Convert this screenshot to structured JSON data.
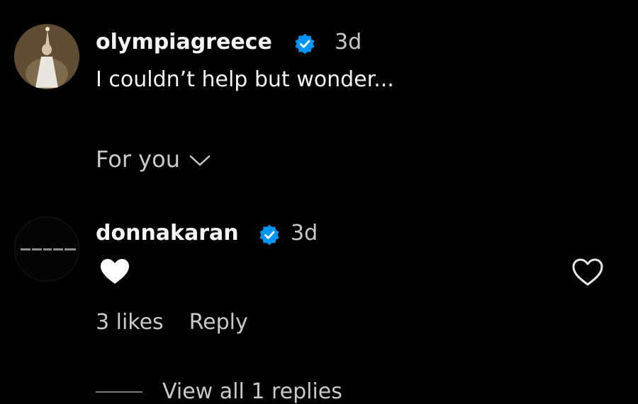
{
  "post": {
    "author": "olympiagreece",
    "verified_icon": "verified-badge-icon",
    "time": "3d",
    "caption": "I couldn’t help but wonder..."
  },
  "sort": {
    "label": "For you",
    "icon": "chevron-down-icon"
  },
  "comment": {
    "author": "donnakaran",
    "verified_icon": "verified-badge-icon",
    "time": "3d",
    "text_icon": "white-heart-emoji",
    "likes": "3 likes",
    "reply_label": "Reply",
    "like_icon": "heart-outline-icon",
    "view_replies": "View all 1 replies"
  },
  "colors": {
    "background": "#000000",
    "text_primary": "#f5f5f5",
    "text_secondary": "#c9c9c9",
    "verified": "#0095f6"
  }
}
